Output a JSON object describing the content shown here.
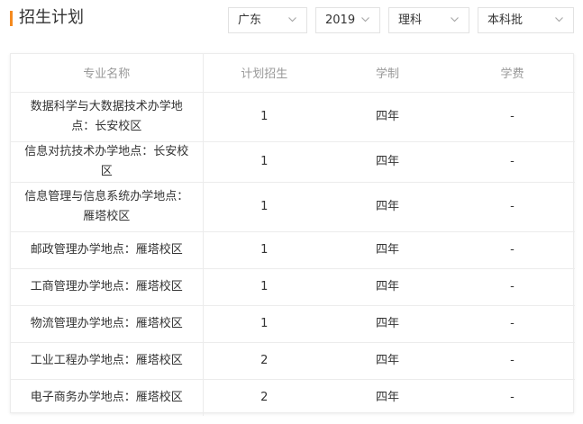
{
  "header": {
    "title": "招生计划"
  },
  "filters": {
    "province": "广东",
    "year": "2019",
    "subject_type": "理科",
    "batch": "本科批"
  },
  "table": {
    "columns": [
      "专业名称",
      "计划招生",
      "学制",
      "学费"
    ],
    "rows": [
      {
        "major": "数据科学与大数据技术办学地点：长安校区",
        "plan": "1",
        "duration": "四年",
        "fee": "-"
      },
      {
        "major": "信息对抗技术办学地点：长安校区",
        "plan": "1",
        "duration": "四年",
        "fee": "-"
      },
      {
        "major": "信息管理与信息系统办学地点：雁塔校区",
        "plan": "1",
        "duration": "四年",
        "fee": "-"
      },
      {
        "major": "邮政管理办学地点：雁塔校区",
        "plan": "1",
        "duration": "四年",
        "fee": "-"
      },
      {
        "major": "工商管理办学地点：雁塔校区",
        "plan": "1",
        "duration": "四年",
        "fee": "-"
      },
      {
        "major": "物流管理办学地点：雁塔校区",
        "plan": "1",
        "duration": "四年",
        "fee": "-"
      },
      {
        "major": "工业工程办学地点：雁塔校区",
        "plan": "2",
        "duration": "四年",
        "fee": "-"
      },
      {
        "major": "电子商务办学地点：雁塔校区",
        "plan": "2",
        "duration": "四年",
        "fee": "-"
      }
    ]
  },
  "colors": {
    "accent": "#f58a1f",
    "border": "#ececec",
    "header_text": "#999999"
  }
}
